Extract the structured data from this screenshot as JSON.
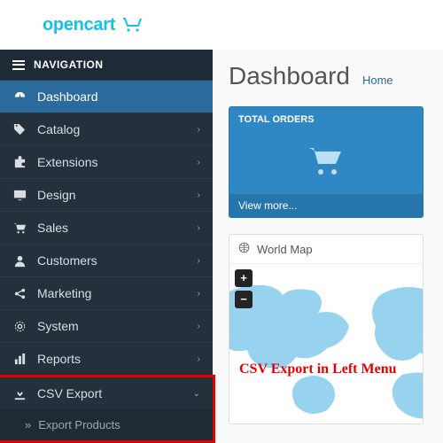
{
  "brand": {
    "name": "opencart"
  },
  "nav": {
    "header": "NAVIGATION",
    "items": [
      {
        "label": "Dashboard",
        "icon": "gauge"
      },
      {
        "label": "Catalog",
        "icon": "tags"
      },
      {
        "label": "Extensions",
        "icon": "puzzle"
      },
      {
        "label": "Design",
        "icon": "desktop"
      },
      {
        "label": "Sales",
        "icon": "cart"
      },
      {
        "label": "Customers",
        "icon": "user"
      },
      {
        "label": "Marketing",
        "icon": "share"
      },
      {
        "label": "System",
        "icon": "cog"
      },
      {
        "label": "Reports",
        "icon": "bars"
      },
      {
        "label": "CSV Export",
        "icon": "download"
      }
    ],
    "csv_sub": "Export Products"
  },
  "page": {
    "title": "Dashboard",
    "crumb": "Home"
  },
  "widget": {
    "title": "TOTAL ORDERS",
    "footer": "View more..."
  },
  "world": {
    "title": "World Map",
    "zoom_in": "+",
    "zoom_out": "−"
  },
  "annotation": "CSV Export in Left Menu"
}
